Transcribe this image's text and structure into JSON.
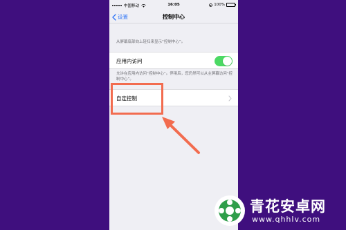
{
  "status_bar": {
    "carrier": "中国移动",
    "time": "16:05",
    "battery_percent": "100%"
  },
  "nav": {
    "back_label": "设置",
    "title": "控制中心"
  },
  "hint_top": "从屏幕底部向上轻扫来显示“控制中心”。",
  "access_row": {
    "label": "应用内访问",
    "toggle_on": true
  },
  "hint_access": "允许在应用内访问“控制中心”。停用后，您仍然可以从主屏幕访问“控制中心”。",
  "custom_row": {
    "label": "自定控制"
  },
  "watermark": {
    "title": "青花安卓网",
    "url": "www.qhhlv.com"
  },
  "colors": {
    "background": "#3f0f7e",
    "accent": "#3478f6",
    "toggle_on": "#4cd964",
    "highlight": "#f26c4f"
  },
  "icons": [
    "signal-icon",
    "wifi-icon",
    "back-chevron-icon",
    "lock-rotation-icon",
    "battery-icon",
    "chevron-right-icon",
    "watermark-logo-icon"
  ]
}
